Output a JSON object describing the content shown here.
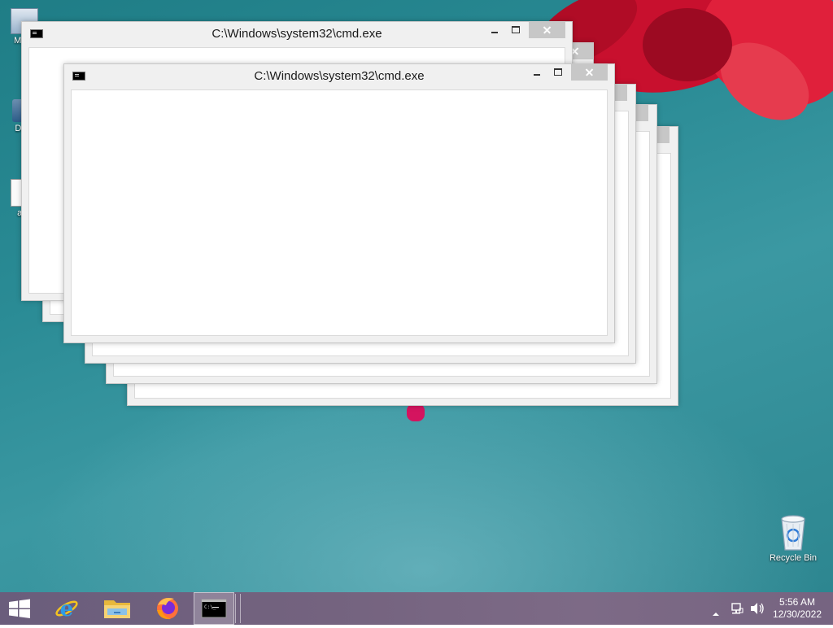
{
  "desktop": {
    "icons": [
      {
        "label": "My C"
      },
      {
        "label": "Data"
      },
      {
        "label": "ar"
      },
      {
        "label": "Recycle Bin"
      }
    ]
  },
  "windows": [
    {
      "title": "C:\\Windows\\system32\\cmd.exe"
    },
    {
      "title": "C:\\Windows\\system32\\cmd.exe"
    }
  ],
  "taskbar": {
    "apps": [
      "start",
      "internet-explorer",
      "file-explorer",
      "firefox",
      "command-prompt"
    ],
    "active_app": "command-prompt",
    "clock": {
      "time": "5:56 AM",
      "date": "12/30/2022"
    }
  },
  "colors": {
    "desktop": "#2a8b95",
    "taskbar": "#74637f",
    "flower": "#d4142e"
  }
}
